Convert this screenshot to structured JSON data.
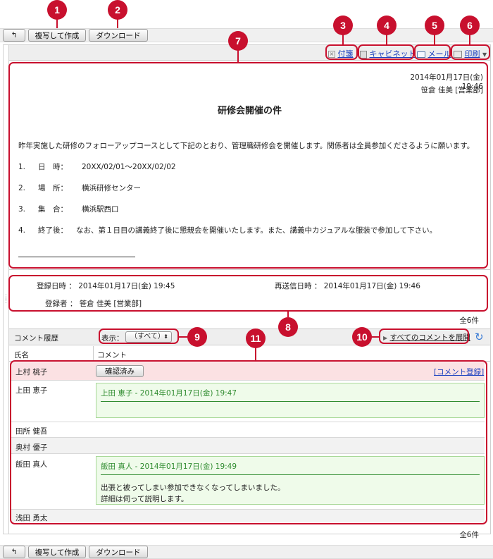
{
  "toolbar": {
    "back_label": "↰",
    "copy_label": "複写して作成",
    "download_label": "ダウンロード"
  },
  "actions": {
    "sticky": "付箋",
    "cabinet": "キャビネット",
    "mail": "メール",
    "print": "印刷"
  },
  "message": {
    "date": "2014年01月17日(金) 19:46",
    "author": "笹倉 佳美 [営業部]",
    "title": "研修会開催の件",
    "body": "昨年実施した研修のフォローアップコースとして下記のとおり、管理職研修会を開催します。関係者は全員参加くださるように願います。",
    "items": [
      {
        "no": "1.",
        "label": "日　時：",
        "value": "20XX/02/01〜20XX/02/02"
      },
      {
        "no": "2.",
        "label": "場　所：",
        "value": "横浜研修センター"
      },
      {
        "no": "3.",
        "label": "集　合：",
        "value": "横浜駅西口"
      },
      {
        "no": "4.",
        "label": "終了後：",
        "value": "なお、第１日目の講義終了後に懇親会を開催いたします。また、講義中カジュアルな服装で参加して下さい。"
      }
    ],
    "signature_line": "————————————————————"
  },
  "meta": {
    "registered_label": "登録日時",
    "registered_value": "2014年01月17日(金) 19:45",
    "resent_label": "再送信日時",
    "resent_value": "2014年01月17日(金) 19:46",
    "registrant_label": "登録者",
    "registrant_value": "笹倉 佳美 [営業部]",
    "colon": "："
  },
  "count": {
    "top": "全6件",
    "bottom": "全6件"
  },
  "comments": {
    "header": "コメント履歴",
    "display_label": "表示：",
    "display_select": "（すべて）",
    "expand_all": "すべてのコメントを展開",
    "col_name": "氏名",
    "col_comment": "コメント",
    "confirmed_button": "確認済み",
    "register_link": "[コメント登録]",
    "rows": [
      {
        "name": "上村 桃子"
      },
      {
        "name": "上田 恵子",
        "comment_head": "上田 恵子  - 2014年01月17日(金) 19:47"
      },
      {
        "name": "田所 健吾"
      },
      {
        "name": "奥村 優子"
      },
      {
        "name": "飯田 真人",
        "comment_head": "飯田 真人  - 2014年01月17日(金) 19:49",
        "line1": "出張と被ってしまい参加できなくなってしまいました。",
        "line2": "詳細は伺って説明します。"
      },
      {
        "name": "浅田 勇太"
      }
    ]
  },
  "markers": [
    "1",
    "2",
    "3",
    "4",
    "5",
    "6",
    "7",
    "8",
    "9",
    "10",
    "11"
  ],
  "colors": {
    "accent": "#c8102e",
    "link": "#1a3fbf",
    "comment_green": "#2e8b2e",
    "highlight_row": "#fbe1e3"
  }
}
